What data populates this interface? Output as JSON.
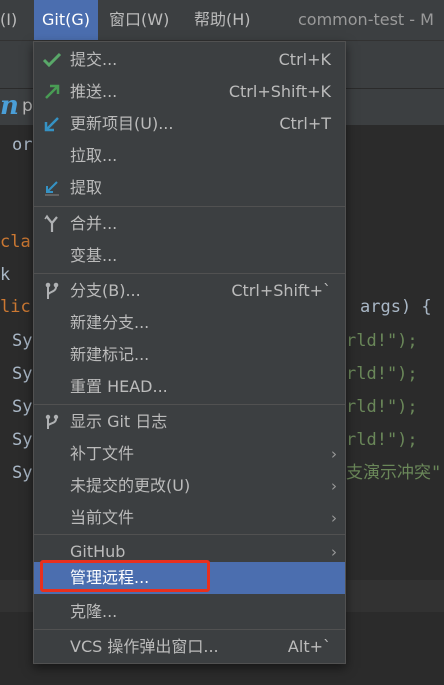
{
  "menubar": {
    "items": [
      {
        "label": "(I)"
      },
      {
        "label": "Git(G)",
        "active": true
      },
      {
        "label": "窗口(W)"
      },
      {
        "label": "帮助(H)"
      }
    ],
    "project_title": "common-test - M"
  },
  "editor": {
    "tab_name": "p",
    "lines": [
      {
        "kind": "plain",
        "text": "or"
      },
      {
        "kind": "kw",
        "text": "cla"
      },
      {
        "kind": "plain",
        "text": "k"
      },
      {
        "kind": "kw",
        "text": "lic"
      },
      {
        "kind": "plain",
        "text": "Sy"
      },
      {
        "kind": "plain",
        "text": "Sy"
      },
      {
        "kind": "plain",
        "text": "Sy"
      },
      {
        "kind": "plain",
        "text": "Sy"
      },
      {
        "kind": "plain",
        "text": "Sy"
      }
    ],
    "right_fragments": [
      "args) {",
      "rld!\");",
      "rld!\");",
      "rld!\");",
      "rld!\");",
      "支演示冲突\""
    ]
  },
  "git_menu": {
    "items": [
      {
        "label": "提交...",
        "shortcut": "Ctrl+K",
        "icon": "check-icon"
      },
      {
        "label": "推送...",
        "shortcut": "Ctrl+Shift+K",
        "icon": "push-arrow-icon"
      },
      {
        "label": "更新项目(U)...",
        "shortcut": "Ctrl+T",
        "icon": "update-arrow-icon"
      },
      {
        "label": "拉取...",
        "shortcut": "",
        "icon": ""
      },
      {
        "label": "提取",
        "shortcut": "",
        "icon": "fetch-icon"
      },
      {
        "label": "合并...",
        "shortcut": "",
        "icon": "merge-icon"
      },
      {
        "label": "变基...",
        "shortcut": "",
        "icon": ""
      },
      {
        "label": "分支(B)...",
        "shortcut": "Ctrl+Shift+`",
        "icon": "branch-icon"
      },
      {
        "label": "新建分支...",
        "shortcut": "",
        "icon": ""
      },
      {
        "label": "新建标记...",
        "shortcut": "",
        "icon": ""
      },
      {
        "label": "重置 HEAD...",
        "shortcut": "",
        "icon": ""
      },
      {
        "label": "显示 Git 日志",
        "shortcut": "",
        "icon": "git-log-icon"
      },
      {
        "label": "补丁文件",
        "shortcut": "",
        "icon": "",
        "submenu": true
      },
      {
        "label": "未提交的更改(U)",
        "shortcut": "",
        "icon": "",
        "submenu": true
      },
      {
        "label": "当前文件",
        "shortcut": "",
        "icon": "",
        "submenu": true
      },
      {
        "label": "GitHub",
        "shortcut": "",
        "icon": "",
        "submenu": true
      },
      {
        "label": "管理远程...",
        "shortcut": "",
        "icon": "",
        "selected": true
      },
      {
        "label": "克隆...",
        "shortcut": "",
        "icon": ""
      },
      {
        "label": "VCS 操作弹出窗口...",
        "shortcut": "Alt+`",
        "icon": ""
      }
    ],
    "submenu_arrow": "›"
  },
  "colors": {
    "accent": "#4b6eaf",
    "highlight_border": "#e8301e",
    "check": "#59a869",
    "push": "#499c54",
    "update": "#3592c4"
  }
}
